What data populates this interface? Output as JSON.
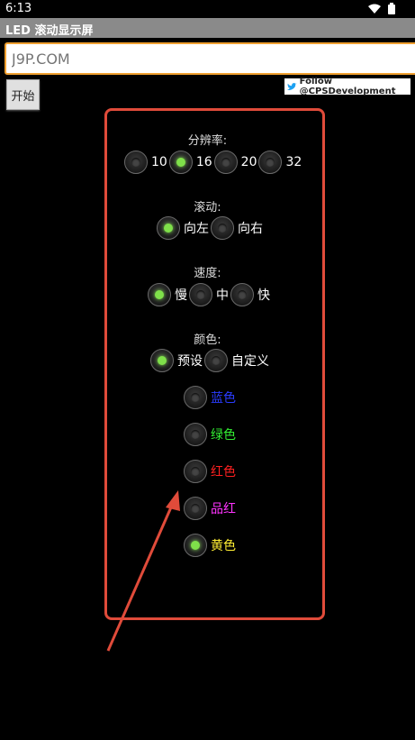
{
  "status": {
    "time": "6:13"
  },
  "app": {
    "title": "LED 滚动显示屏"
  },
  "url_input": {
    "placeholder": "J9P.COM"
  },
  "toolbar": {
    "start_label": "开始",
    "follow_text": "Follow @CPSDevelopment"
  },
  "resolution": {
    "label": "分辨率:",
    "options": [
      "10",
      "16",
      "20",
      "32"
    ],
    "selected": "16"
  },
  "scroll": {
    "label": "滚动:",
    "options": [
      "向左",
      "向右"
    ],
    "selected": "向左"
  },
  "speed": {
    "label": "速度:",
    "options": [
      "慢",
      "中",
      "快"
    ],
    "selected": "慢"
  },
  "color": {
    "label": "颜色:",
    "options": [
      "预设",
      "自定义"
    ],
    "selected": "预设",
    "presets": [
      {
        "label": "蓝色",
        "color": "#2a3cff"
      },
      {
        "label": "绿色",
        "color": "#33ee33"
      },
      {
        "label": "红色",
        "color": "#ff2020"
      },
      {
        "label": "品红",
        "color": "#ff33ff"
      },
      {
        "label": "黄色",
        "color": "#ffee33"
      }
    ],
    "preset_selected": "黄色"
  },
  "colors": {
    "accent_input": "#f0a030",
    "frame": "#e04b3a",
    "radio_on": "#7fe04a",
    "title_bar": "#8a8a8a"
  }
}
